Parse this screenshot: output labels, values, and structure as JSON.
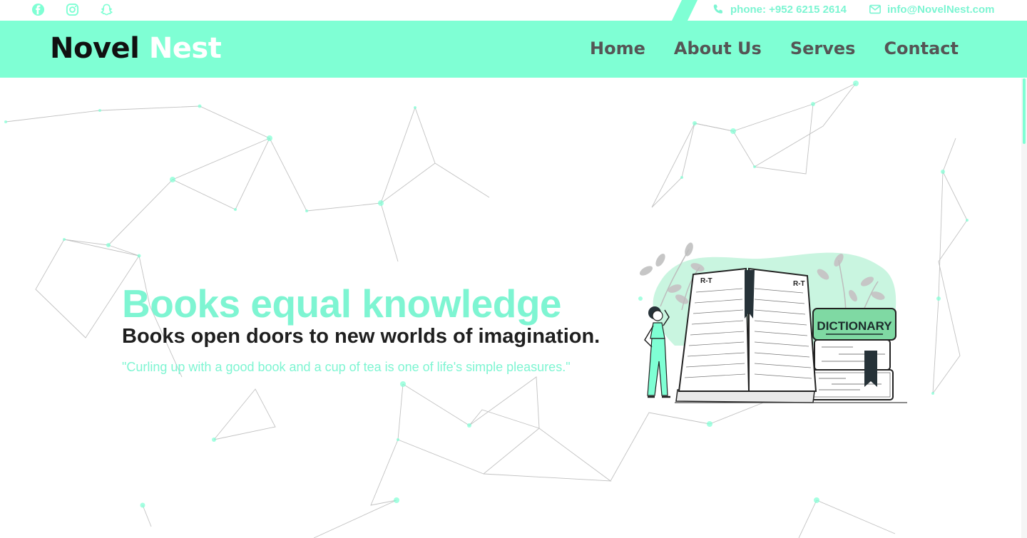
{
  "topbar": {
    "social_icons": [
      "facebook-icon",
      "instagram-icon",
      "snapchat-icon"
    ],
    "phone_text": "phone: +952 6215 2614",
    "email_text": "info@NovelNest.com"
  },
  "brand": {
    "part1": "Novel",
    "part2": "Nest"
  },
  "nav": {
    "items": [
      {
        "label": "Home"
      },
      {
        "label": "About Us"
      },
      {
        "label": "Serves"
      },
      {
        "label": "Contact"
      }
    ]
  },
  "hero": {
    "title": "Books equal knowledge",
    "subtitle": "Books open doors to new worlds of imagination.",
    "quote": "\"Curling up with a good book and a cup of tea is one of life's simple pleasures.\""
  },
  "illustration": {
    "page_label_left": "R-T",
    "page_label_right": "R-T",
    "book_label": "DICTIONARY"
  },
  "colors": {
    "accent": "#7fffd4",
    "accent_text": "#7ef5d2",
    "nav_text": "#555555",
    "brand_dark": "#111111"
  }
}
